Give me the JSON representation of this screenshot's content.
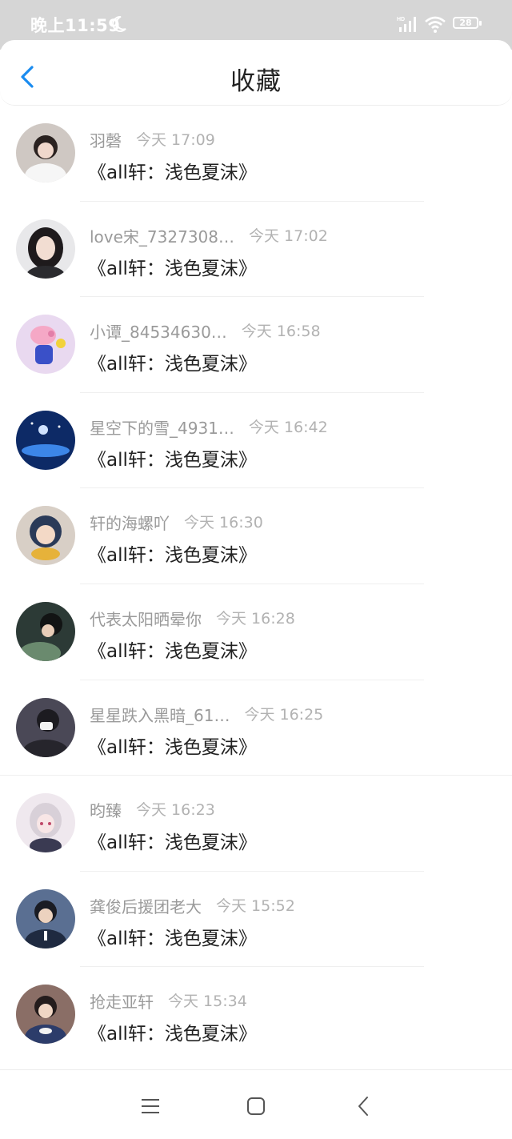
{
  "status_bar": {
    "time": "晚上11:59",
    "battery": "28",
    "network": "HD"
  },
  "header": {
    "title": "收藏"
  },
  "items": [
    {
      "name": "羽磬",
      "time": "今天 17:09",
      "message": "《all轩：浅色夏沫》",
      "avatar_color": "#cfc8c3"
    },
    {
      "name": "love宋_7327308…",
      "time": "今天 17:02",
      "message": "《all轩：浅色夏沫》",
      "avatar_color": "#b8b3b6"
    },
    {
      "name": "小谭_84534630…",
      "time": "今天 16:58",
      "message": "《all轩：浅色夏沫》",
      "avatar_color": "#e9d9f0"
    },
    {
      "name": "星空下的雪_4931…",
      "time": "今天 16:42",
      "message": "《all轩：浅色夏沫》",
      "avatar_color": "#173f88"
    },
    {
      "name": "轩的海螺吖",
      "time": "今天 16:30",
      "message": "《all轩：浅色夏沫》",
      "avatar_color": "#c9b8a8"
    },
    {
      "name": "代表太阳晒晕你",
      "time": "今天 16:28",
      "message": "《all轩：浅色夏沫》",
      "avatar_color": "#3a4a44"
    },
    {
      "name": "星星跌入黑暗_61…",
      "time": "今天 16:25",
      "message": "《all轩：浅色夏沫》",
      "avatar_color": "#3b3a44"
    },
    {
      "name": "昀臻",
      "time": "今天 16:23",
      "message": "《all轩：浅色夏沫》",
      "avatar_color": "#ece3ea"
    },
    {
      "name": "龚俊后援团老大",
      "time": "今天 15:52",
      "message": "《all轩：浅色夏沫》",
      "avatar_color": "#4a5a72"
    },
    {
      "name": "抢走亚轩",
      "time": "今天 15:34",
      "message": "《all轩：浅色夏沫》",
      "avatar_color": "#6b5a58"
    }
  ],
  "colors": {
    "accent": "#1a8cf0",
    "statusbar": "#d6d6d6"
  },
  "icons": {
    "back": "chevron-left-icon",
    "menu": "menu-icon",
    "home": "home-icon",
    "nav_back": "nav-back-icon"
  }
}
